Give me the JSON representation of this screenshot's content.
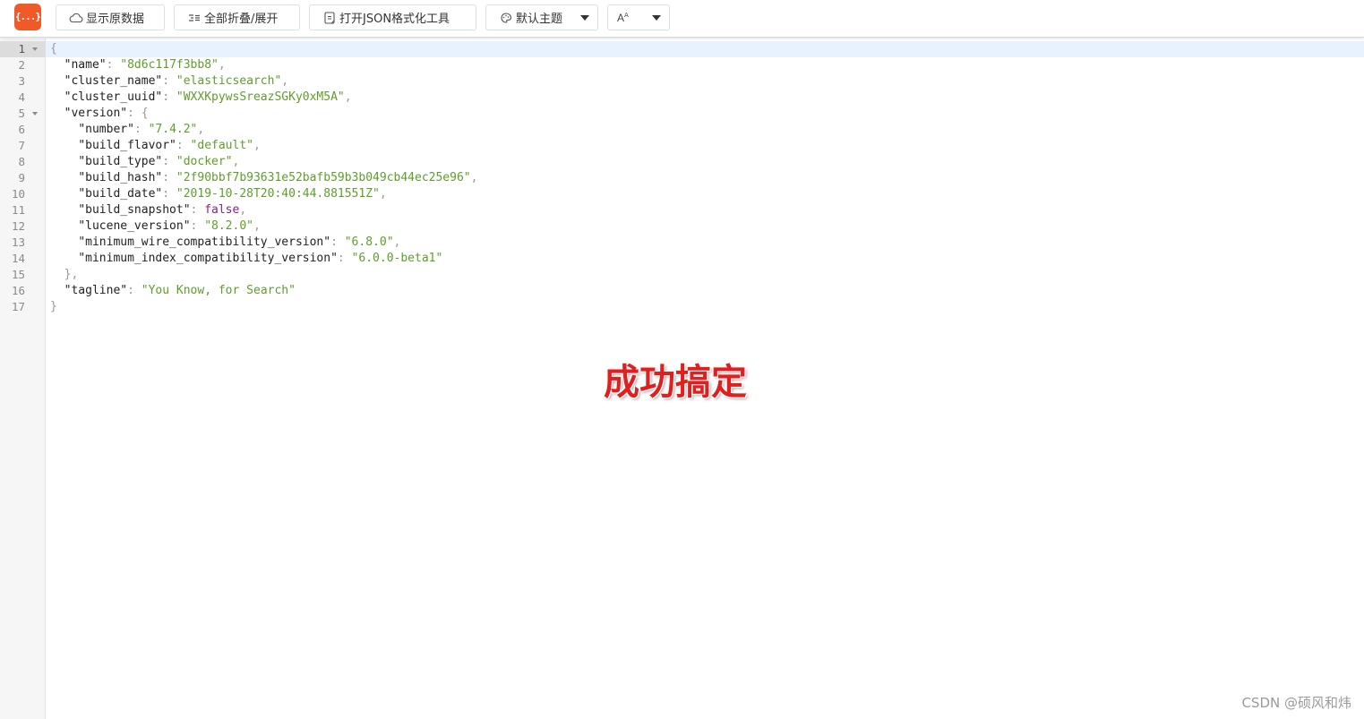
{
  "toolbar": {
    "logo_text": "{...}",
    "buttons": [
      {
        "label": "显示原数据",
        "icon": "cloud-icon"
      },
      {
        "label": "全部折叠/展开",
        "icon": "collapse-lines-icon"
      },
      {
        "label": "打开JSON格式化工具",
        "icon": "json-tool-icon"
      }
    ],
    "theme_select": {
      "label": "默认主题",
      "icon": "palette-icon"
    },
    "font_select": {
      "label": "A",
      "icon": "font-size-icon"
    }
  },
  "editor": {
    "line_numbers": [
      "1",
      "2",
      "3",
      "4",
      "5",
      "6",
      "7",
      "8",
      "9",
      "10",
      "11",
      "12",
      "13",
      "14",
      "15",
      "16",
      "17"
    ],
    "foldable_lines": [
      1,
      5
    ],
    "lines": [
      {
        "indent": "",
        "parts": [
          {
            "t": "p",
            "v": "{"
          }
        ]
      },
      {
        "indent": "  ",
        "parts": [
          {
            "t": "k",
            "v": "\"name\""
          },
          {
            "t": "p",
            "v": ": "
          },
          {
            "t": "s",
            "v": "\"8d6c117f3bb8\""
          },
          {
            "t": "p",
            "v": ","
          }
        ]
      },
      {
        "indent": "  ",
        "parts": [
          {
            "t": "k",
            "v": "\"cluster_name\""
          },
          {
            "t": "p",
            "v": ": "
          },
          {
            "t": "s",
            "v": "\"elasticsearch\""
          },
          {
            "t": "p",
            "v": ","
          }
        ]
      },
      {
        "indent": "  ",
        "parts": [
          {
            "t": "k",
            "v": "\"cluster_uuid\""
          },
          {
            "t": "p",
            "v": ": "
          },
          {
            "t": "s",
            "v": "\"WXXKpywsSreazSGKy0xM5A\""
          },
          {
            "t": "p",
            "v": ","
          }
        ]
      },
      {
        "indent": "  ",
        "parts": [
          {
            "t": "k",
            "v": "\"version\""
          },
          {
            "t": "p",
            "v": ": {"
          }
        ]
      },
      {
        "indent": "    ",
        "parts": [
          {
            "t": "k",
            "v": "\"number\""
          },
          {
            "t": "p",
            "v": ": "
          },
          {
            "t": "s",
            "v": "\"7.4.2\""
          },
          {
            "t": "p",
            "v": ","
          }
        ]
      },
      {
        "indent": "    ",
        "parts": [
          {
            "t": "k",
            "v": "\"build_flavor\""
          },
          {
            "t": "p",
            "v": ": "
          },
          {
            "t": "s",
            "v": "\"default\""
          },
          {
            "t": "p",
            "v": ","
          }
        ]
      },
      {
        "indent": "    ",
        "parts": [
          {
            "t": "k",
            "v": "\"build_type\""
          },
          {
            "t": "p",
            "v": ": "
          },
          {
            "t": "s",
            "v": "\"docker\""
          },
          {
            "t": "p",
            "v": ","
          }
        ]
      },
      {
        "indent": "    ",
        "parts": [
          {
            "t": "k",
            "v": "\"build_hash\""
          },
          {
            "t": "p",
            "v": ": "
          },
          {
            "t": "s",
            "v": "\"2f90bbf7b93631e52bafb59b3b049cb44ec25e96\""
          },
          {
            "t": "p",
            "v": ","
          }
        ]
      },
      {
        "indent": "    ",
        "parts": [
          {
            "t": "k",
            "v": "\"build_date\""
          },
          {
            "t": "p",
            "v": ": "
          },
          {
            "t": "s",
            "v": "\"2019-10-28T20:40:44.881551Z\""
          },
          {
            "t": "p",
            "v": ","
          }
        ]
      },
      {
        "indent": "    ",
        "parts": [
          {
            "t": "k",
            "v": "\"build_snapshot\""
          },
          {
            "t": "p",
            "v": ": "
          },
          {
            "t": "b",
            "v": "false"
          },
          {
            "t": "p",
            "v": ","
          }
        ]
      },
      {
        "indent": "    ",
        "parts": [
          {
            "t": "k",
            "v": "\"lucene_version\""
          },
          {
            "t": "p",
            "v": ": "
          },
          {
            "t": "s",
            "v": "\"8.2.0\""
          },
          {
            "t": "p",
            "v": ","
          }
        ]
      },
      {
        "indent": "    ",
        "parts": [
          {
            "t": "k",
            "v": "\"minimum_wire_compatibility_version\""
          },
          {
            "t": "p",
            "v": ": "
          },
          {
            "t": "s",
            "v": "\"6.8.0\""
          },
          {
            "t": "p",
            "v": ","
          }
        ]
      },
      {
        "indent": "    ",
        "parts": [
          {
            "t": "k",
            "v": "\"minimum_index_compatibility_version\""
          },
          {
            "t": "p",
            "v": ": "
          },
          {
            "t": "s",
            "v": "\"6.0.0-beta1\""
          }
        ]
      },
      {
        "indent": "  ",
        "parts": [
          {
            "t": "p",
            "v": "},"
          }
        ]
      },
      {
        "indent": "  ",
        "parts": [
          {
            "t": "k",
            "v": "\"tagline\""
          },
          {
            "t": "p",
            "v": ": "
          },
          {
            "t": "s",
            "v": "\"You Know, for Search\""
          }
        ]
      },
      {
        "indent": "",
        "parts": [
          {
            "t": "p",
            "v": "}"
          }
        ]
      }
    ]
  },
  "overlay": {
    "text": "成功搞定"
  },
  "watermark": {
    "text": "CSDN @硕风和炜"
  },
  "colors": {
    "logo_bg": "#f05a28",
    "string": "#5f9d2b",
    "boolean": "#8a1f8a",
    "active_line": "#e8f2ff",
    "overlay_text": "#e02020"
  }
}
